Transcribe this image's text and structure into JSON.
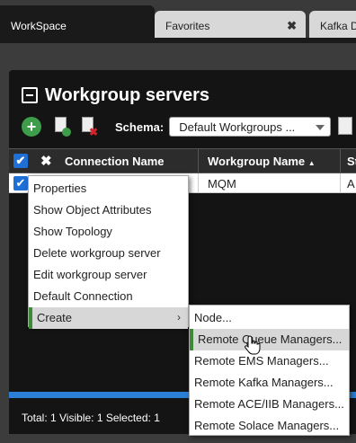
{
  "tabs": [
    {
      "label": "WorkSpace"
    },
    {
      "label": "Favorites",
      "close": "✖"
    },
    {
      "label": "Kafka D"
    }
  ],
  "panel": {
    "title": "Workgroup servers",
    "schema_label": "Schema:",
    "schema_value": "Default Workgroups ..."
  },
  "grid": {
    "columns": [
      "Connection Name",
      "Workgroup Name",
      "St"
    ],
    "sort_indicator": "▲",
    "rows": [
      {
        "connection": "",
        "workgroup": "MQM",
        "status": "A"
      }
    ]
  },
  "status_bar": "Total: 1 Visible: 1 Selected: 1",
  "context_menu": {
    "items": [
      "Properties",
      "Show Object Attributes",
      "Show Topology",
      "Delete workgroup server",
      "Edit workgroup server",
      "Default Connection",
      "Create"
    ],
    "submenu_arrow": "›"
  },
  "create_submenu": {
    "items": [
      "Node...",
      "Remote Queue Managers...",
      "Remote EMS Managers...",
      "Remote Kafka Managers...",
      "Remote ACE/IIB Managers...",
      "Remote Solace Managers..."
    ]
  },
  "colors": {
    "accent": "#1e6fd6",
    "active_marker": "#3d8a37",
    "add_green": "#3d9d4a"
  }
}
